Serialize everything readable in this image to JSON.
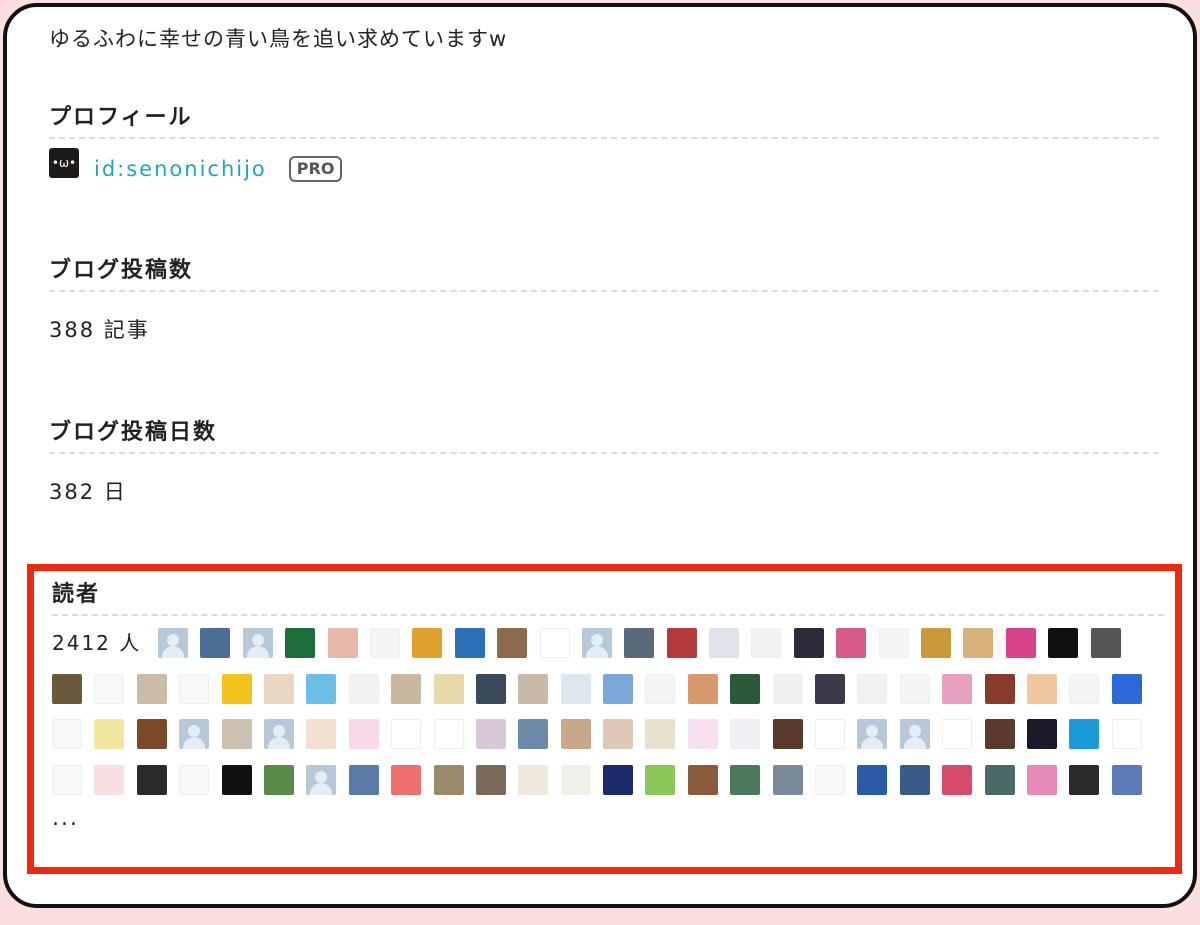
{
  "description": "ゆるふわに幸せの青い鳥を追い求めていますw",
  "profile": {
    "title": "プロフィール",
    "avatar_text": "•ω•",
    "user_id": "id:senonichijo",
    "badge": "PRO"
  },
  "posts": {
    "title": "ブログ投稿数",
    "value": "388 記事"
  },
  "days": {
    "title": "ブログ投稿日数",
    "value": "382 日"
  },
  "readers": {
    "title": "読者",
    "count": "2412 人",
    "more": "...",
    "icons": [
      "default",
      "#4a6e96",
      "default",
      "#1e6e3a",
      "#e8b7a8",
      "#f5f5f5",
      "#e0a030",
      "#2a6fb8",
      "#8b6b4a",
      "#ffffff",
      "default",
      "#5a6a7a",
      "#b23a3a",
      "#dfe4ea",
      "#f2f2f2",
      "#2b2b3a",
      "#d65a8a",
      "#f5f5f5",
      "#c89a3a",
      "#d9b27a",
      "#d8428a",
      "#111111",
      "#555555",
      "#6b5a3a",
      "#f8f8f8",
      "#cbbca8",
      "#f8f8f8",
      "#f4c21a",
      "#e8d6c0",
      "#6cc0e8",
      "#f2f2f2",
      "#c8b8a0",
      "#e8d9a8",
      "#3a4a5a",
      "#c8b8a8",
      "#dde8f0",
      "#7aa8d8",
      "#f5f5f5",
      "#d89a6a",
      "#2a5a3a",
      "#f0f0f0",
      "#3a3a4a",
      "#f2f2f2",
      "#f5f5f5",
      "#e8a0c0",
      "#8a3a2a",
      "#f0c8a0",
      "#f5f5f5",
      "#2a6ad8",
      "#f8f8f8",
      "#f0e8a0",
      "#7a4a2a",
      "default",
      "#ccc0b0",
      "default",
      "#f0e0d0",
      "#f8d8e8",
      "#ffffff",
      "#ffffff",
      "#d8c8d8",
      "#6a8aa8",
      "#c8a888",
      "#e0c8b8",
      "#eae0d0",
      "#f8e0f0",
      "#eef0f4",
      "#5a3a2a",
      "#ffffff",
      "default",
      "default",
      "#ffffff",
      "#5a3a2a",
      "#1a1a2a",
      "#1a9ad8",
      "#ffffff",
      "#f8f8f8",
      "#f8e0e0",
      "#2a2a2a",
      "#f8f8f8",
      "#111111",
      "#5a8a4a",
      "default",
      "#5a7aa8",
      "#f07070",
      "#9a8a6a",
      "#7a6a5a",
      "#efe8dc",
      "#f0f0e8",
      "#1a2a6a",
      "#8ac85a",
      "#8a5a3a",
      "#4a7a5a",
      "#7a8a9a",
      "#f8f8f8",
      "#2a5aa8",
      "#3a5a8a",
      "#d84a6a",
      "#4a6a6a",
      "#e88ab8",
      "#2a2a2a",
      "#5a7ab8"
    ]
  }
}
